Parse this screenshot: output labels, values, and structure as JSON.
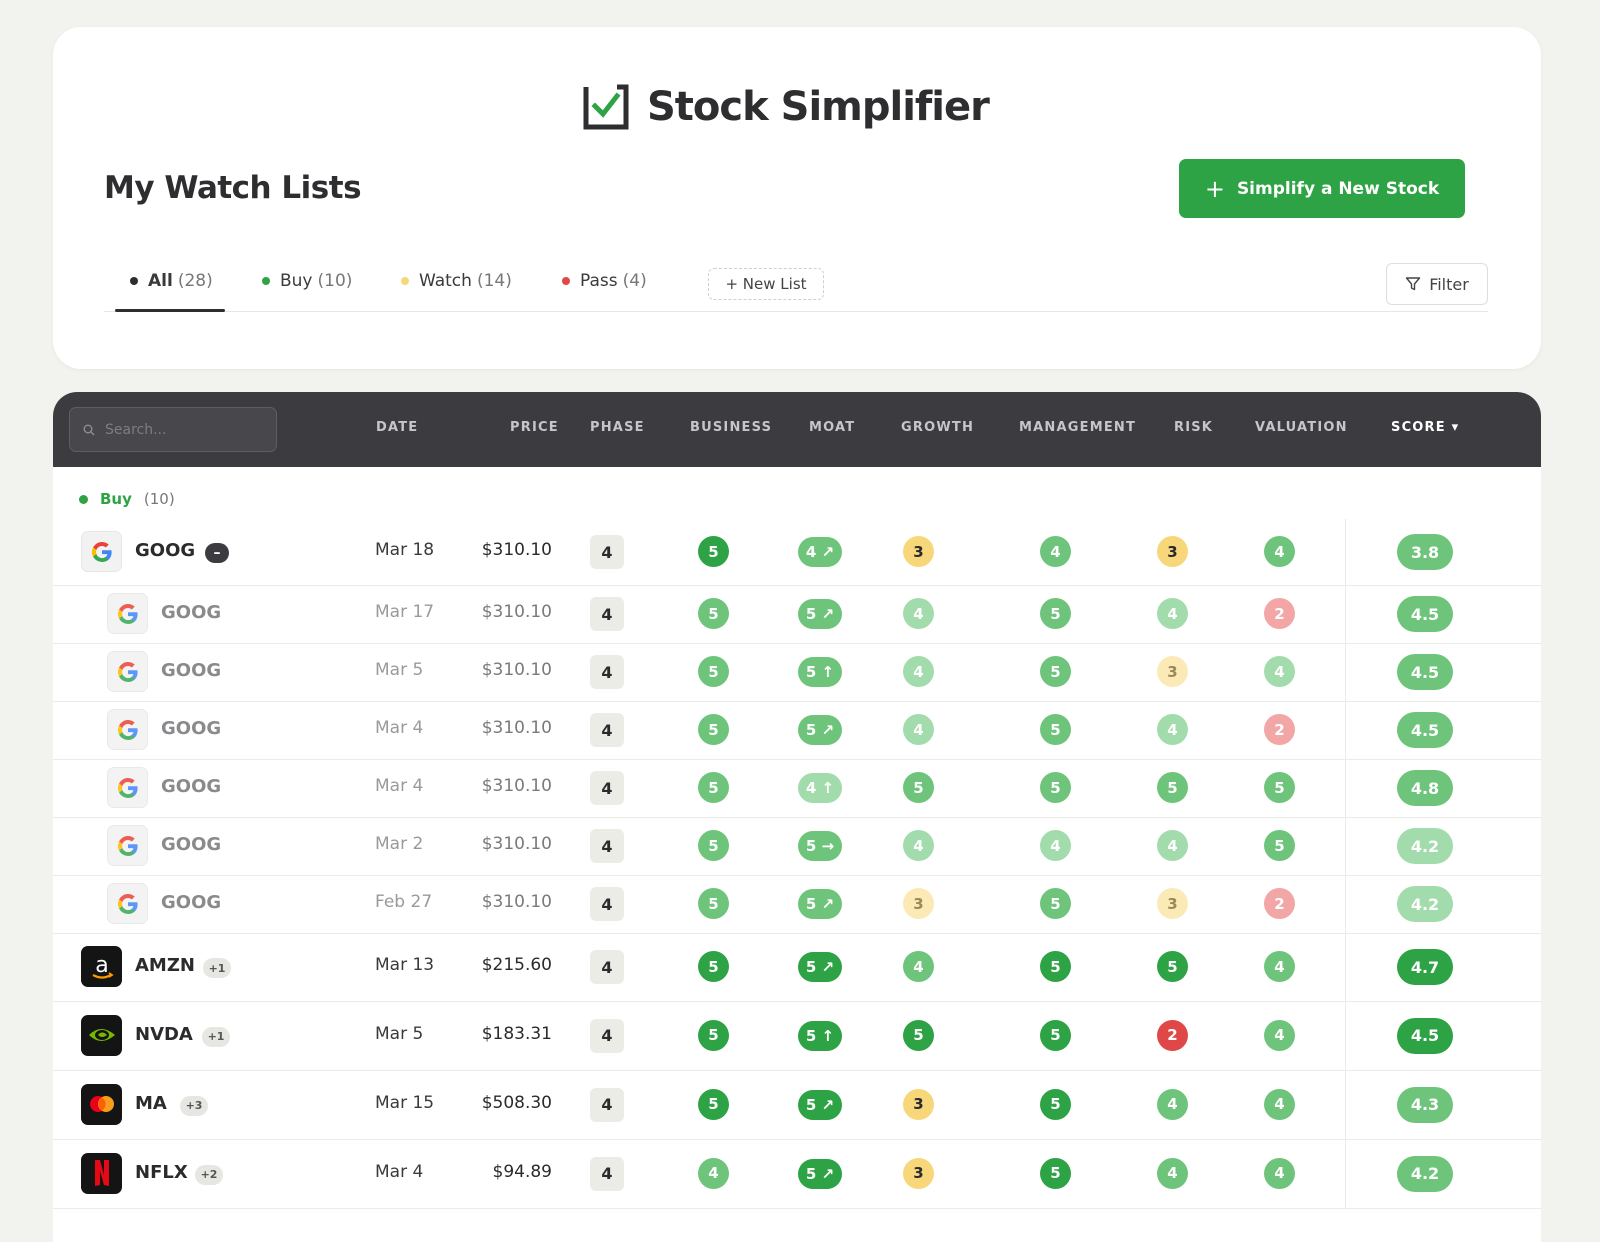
{
  "app": {
    "name": "Stock Simplifier"
  },
  "page": {
    "title": "My Watch Lists"
  },
  "cta": {
    "label": "Simplify a New Stock"
  },
  "tabs": [
    {
      "label": "All",
      "count": "(28)",
      "dot": "#2e2e31",
      "active": true
    },
    {
      "label": "Buy",
      "count": "(10)",
      "dot": "#2ea345",
      "active": false
    },
    {
      "label": "Watch",
      "count": "(14)",
      "dot": "#f7d77a",
      "active": false
    },
    {
      "label": "Pass",
      "count": "(4)",
      "dot": "#e04848",
      "active": false
    }
  ],
  "new_list": {
    "label": "+ New List"
  },
  "filter": {
    "label": "Filter"
  },
  "search": {
    "placeholder": "Search..."
  },
  "columns": {
    "date": "DATE",
    "price": "PRICE",
    "phase": "PHASE",
    "business": "BUSINESS",
    "moat": "MOAT",
    "growth": "GROWTH",
    "management": "MANAGEMENT",
    "risk": "RISK",
    "valuation": "VALUATION",
    "score": "SCORE ▾"
  },
  "group": {
    "name": "Buy",
    "count": "(10)"
  },
  "colors": {
    "accent": "#2ea345",
    "score_dark": "#2ea345",
    "score_mid": "#6fc47c",
    "score_light": "#a3dcac",
    "yellow": "#f7d77a",
    "yellow_light": "#fbeab6",
    "red": "#e04848",
    "red_light": "#f2a6a6",
    "header_bg": "#3c3c40"
  },
  "rows": [
    {
      "ticker": "GOOG",
      "logo": "google-logo",
      "badge": "–",
      "date": "Mar 18",
      "price": "$310.10",
      "phase": "4",
      "business": "5",
      "moat": "4 ↗",
      "growth": "3",
      "management": "4",
      "risk": "3",
      "valuation": "4",
      "score": "3.8",
      "sub": false
    },
    {
      "ticker": "GOOG",
      "logo": "google-logo",
      "date": "Mar 17",
      "price": "$310.10",
      "phase": "4",
      "business": "5",
      "moat": "5 ↗",
      "growth": "4",
      "management": "5",
      "risk": "4",
      "valuation": "2",
      "score": "4.5",
      "sub": true
    },
    {
      "ticker": "GOOG",
      "logo": "google-logo",
      "date": "Mar 5",
      "price": "$310.10",
      "phase": "4",
      "business": "5",
      "moat": "5 ↑",
      "growth": "4",
      "management": "5",
      "risk": "3",
      "valuation": "4",
      "score": "4.5",
      "sub": true
    },
    {
      "ticker": "GOOG",
      "logo": "google-logo",
      "date": "Mar 4",
      "price": "$310.10",
      "phase": "4",
      "business": "5",
      "moat": "5 ↗",
      "growth": "4",
      "management": "5",
      "risk": "4",
      "valuation": "2",
      "score": "4.5",
      "sub": true
    },
    {
      "ticker": "GOOG",
      "logo": "google-logo",
      "date": "Mar 4",
      "price": "$310.10",
      "phase": "4",
      "business": "5",
      "moat": "4 ↑",
      "growth": "5",
      "management": "5",
      "risk": "5",
      "valuation": "5",
      "score": "4.8",
      "sub": true
    },
    {
      "ticker": "GOOG",
      "logo": "google-logo",
      "date": "Mar 2",
      "price": "$310.10",
      "phase": "4",
      "business": "5",
      "moat": "5 →",
      "growth": "4",
      "management": "4",
      "risk": "4",
      "valuation": "5",
      "score": "4.2",
      "sub": true
    },
    {
      "ticker": "GOOG",
      "logo": "google-logo",
      "date": "Feb 27",
      "price": "$310.10",
      "phase": "4",
      "business": "5",
      "moat": "5 ↗",
      "growth": "3",
      "management": "5",
      "risk": "3",
      "valuation": "2",
      "score": "4.2",
      "sub": true
    },
    {
      "ticker": "AMZN",
      "logo": "amazon-logo",
      "badge": "+1",
      "date": "Mar 13",
      "price": "$215.60",
      "phase": "4",
      "business": "5",
      "moat": "5 ↗",
      "growth": "4",
      "management": "5",
      "risk": "5",
      "valuation": "4",
      "score": "4.7",
      "sub": false
    },
    {
      "ticker": "NVDA",
      "logo": "nvidia-logo",
      "badge": "+1",
      "date": "Mar 5",
      "price": "$183.31",
      "phase": "4",
      "business": "5",
      "moat": "5 ↑",
      "growth": "5",
      "management": "5",
      "risk": "2",
      "valuation": "4",
      "score": "4.5",
      "sub": false
    },
    {
      "ticker": "MA",
      "logo": "mastercard-logo",
      "badge": "+3",
      "date": "Mar 15",
      "price": "$508.30",
      "phase": "4",
      "business": "5",
      "moat": "5 ↗",
      "growth": "3",
      "management": "5",
      "risk": "4",
      "valuation": "4",
      "score": "4.3",
      "sub": false
    },
    {
      "ticker": "NFLX",
      "logo": "netflix-logo",
      "badge": "+2",
      "date": "Mar 4",
      "price": "$94.89",
      "phase": "4",
      "business": "4",
      "moat": "5 ↗",
      "growth": "3",
      "management": "5",
      "risk": "4",
      "valuation": "4",
      "score": "4.2",
      "sub": false
    }
  ]
}
